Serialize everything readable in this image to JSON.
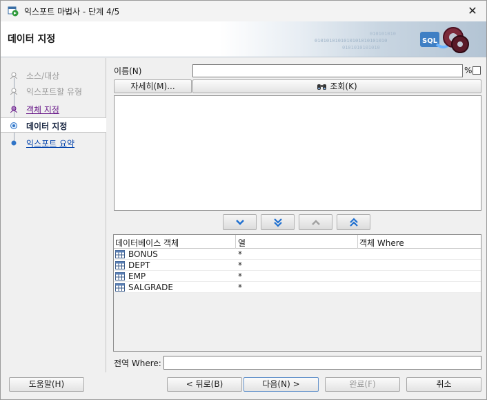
{
  "window": {
    "title": "익스포트 마법사 - 단계 4/5",
    "close_glyph": "✕"
  },
  "banner": {
    "title": "데이터 지정",
    "logo_text": "SQL"
  },
  "nav": {
    "items": [
      {
        "label": "소스/대상",
        "state": "disabled"
      },
      {
        "label": "익스포트할 유형",
        "state": "disabled"
      },
      {
        "label": "객체 지정",
        "state": "visited"
      },
      {
        "label": "데이터 지정",
        "state": "current"
      },
      {
        "label": "익스포트 요약",
        "state": "link"
      }
    ]
  },
  "filter": {
    "name_label": "이름(N)",
    "name_value": "",
    "wildcard": "%",
    "wildcard_checked": false,
    "more_button": "자세히(M)...",
    "lookup_button": "조회(K)"
  },
  "move_buttons": [
    "move-down",
    "move-all-down",
    "move-up",
    "move-all-up"
  ],
  "table": {
    "headers": [
      "데이터베이스 객체",
      "열",
      "객체 Where"
    ],
    "rows": [
      {
        "object": "BONUS",
        "columns": "*",
        "where": ""
      },
      {
        "object": "DEPT",
        "columns": "*",
        "where": ""
      },
      {
        "object": "EMP",
        "columns": "*",
        "where": ""
      },
      {
        "object": "SALGRADE",
        "columns": "*",
        "where": ""
      }
    ]
  },
  "global_where": {
    "label": "전역 Where:",
    "value": ""
  },
  "footer": {
    "help": "도움말(H)",
    "back": "< 뒤로(B)",
    "next": "다음(N) >",
    "finish": "완료(F)",
    "cancel": "취소"
  },
  "colors": {
    "accent": "#1e6fd0",
    "visited_link": "#6a1b8a",
    "link": "#0645ad"
  }
}
